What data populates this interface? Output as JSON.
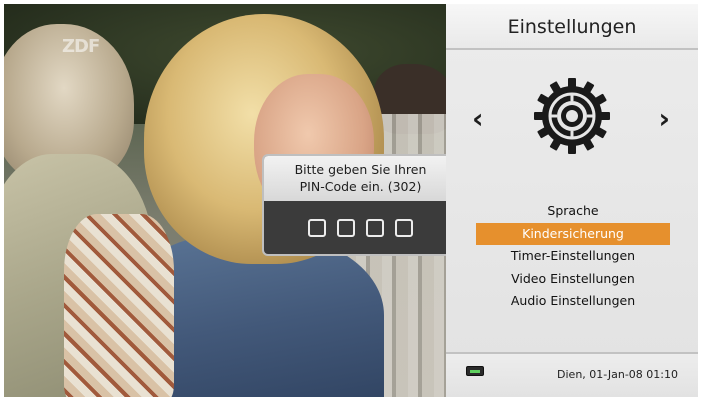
{
  "channel_logo": "ZDF",
  "pin_dialog": {
    "line1": "Bitte geben Sie Ihren",
    "line2": "PIN-Code ein. (302)",
    "digits": 4
  },
  "settings_panel": {
    "title": "Einstellungen",
    "carousel": {
      "left_arrow": "‹",
      "right_arrow": "›",
      "icon": "settings-gear-icon"
    },
    "menu": [
      {
        "label": "Sprache",
        "selected": false
      },
      {
        "label": "Kindersicherung",
        "selected": true
      },
      {
        "label": "Timer-Einstellungen",
        "selected": false
      },
      {
        "label": "Video Einstellungen",
        "selected": false
      },
      {
        "label": "Audio Einstellungen",
        "selected": false
      }
    ],
    "footer": {
      "signal_icon": "signal-status-icon",
      "datetime": "Dien, 01-Jan-08  01:10"
    }
  },
  "colors": {
    "accent": "#e6902d",
    "panel_bg": "#e6e6e6",
    "dialog_bg": "#3b3b3b"
  }
}
